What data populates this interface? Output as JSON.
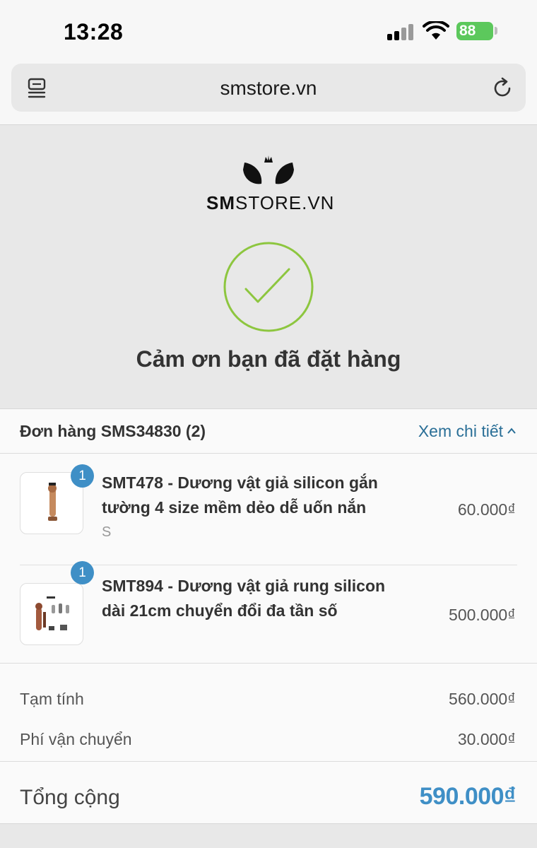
{
  "status_bar": {
    "time": "13:28",
    "battery": "88",
    "icons": [
      "signal-icon",
      "wifi-icon",
      "battery-icon"
    ]
  },
  "browser": {
    "url": "smstore.vn",
    "icons": [
      "menu-icon",
      "reload-icon"
    ]
  },
  "header": {
    "logo_bold": "SM",
    "logo_rest": "STORE.VN",
    "success_icon": "check-circle-icon",
    "thank_you": "Cảm ơn bạn đã đặt hàng"
  },
  "order": {
    "title": "Đơn hàng SMS34830 (2)",
    "detail_link": "Xem chi tiết",
    "items": [
      {
        "quantity": "1",
        "name_line1": "SMT478 - Dương vật giả silicon gắn",
        "name_line2": "tường 4 size mềm dẻo dễ uốn nắn",
        "variant": "S",
        "price": "60.000₫"
      },
      {
        "quantity": "1",
        "name_line1": "SMT894 - Dương vật giả rung silicon",
        "name_line2": "dài 21cm chuyển đổi đa tần số",
        "price": "500.000₫"
      }
    ],
    "subtotal_label": "Tạm tính",
    "subtotal_value": "560.000₫",
    "shipping_label": "Phí vận chuyển",
    "shipping_value": "30.000₫",
    "total_label": "Tổng cộng",
    "total_value": "590.000₫"
  },
  "colors": {
    "accent": "#3f8fc6",
    "link": "#2a6f97",
    "success": "#8dc63f",
    "battery": "#5cc85c"
  }
}
